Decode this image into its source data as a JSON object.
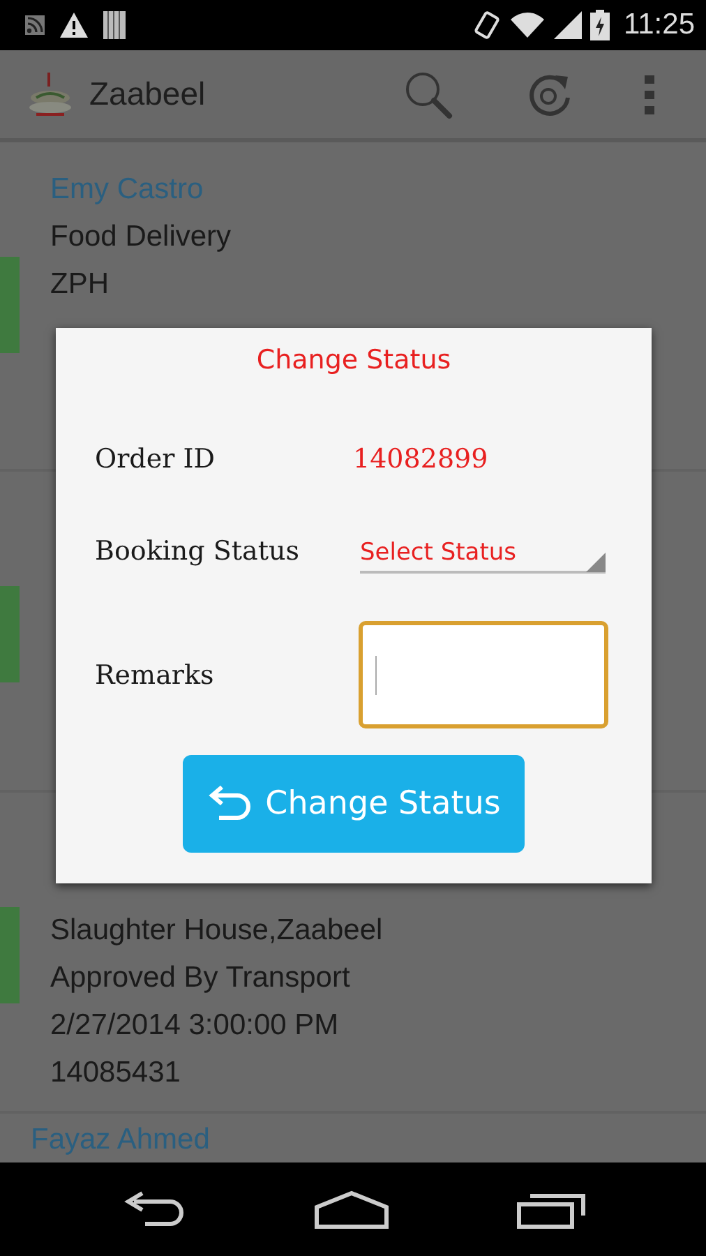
{
  "status_bar": {
    "time": "11:25"
  },
  "app_bar": {
    "title": "Zaabeel"
  },
  "orders": [
    {
      "kind": "order",
      "name": "Emy Castro",
      "lines": [
        "Food Delivery",
        "ZPH"
      ]
    },
    {
      "kind": "covered"
    },
    {
      "kind": "order",
      "lines": [
        "Slaughter House,Zaabeel",
        "Approved By Transport",
        "2/27/2014 3:00:00 PM",
        "14085431"
      ]
    },
    {
      "kind": "order",
      "name": "Fayaz Ahmed"
    }
  ],
  "dialog": {
    "title": "Change Status",
    "order_id": {
      "label": "Order ID",
      "value": "14082899"
    },
    "booking_status": {
      "label": "Booking Status",
      "placeholder": "Select Status"
    },
    "remarks": {
      "label": "Remarks",
      "focused": true
    },
    "button": "Change Status"
  }
}
